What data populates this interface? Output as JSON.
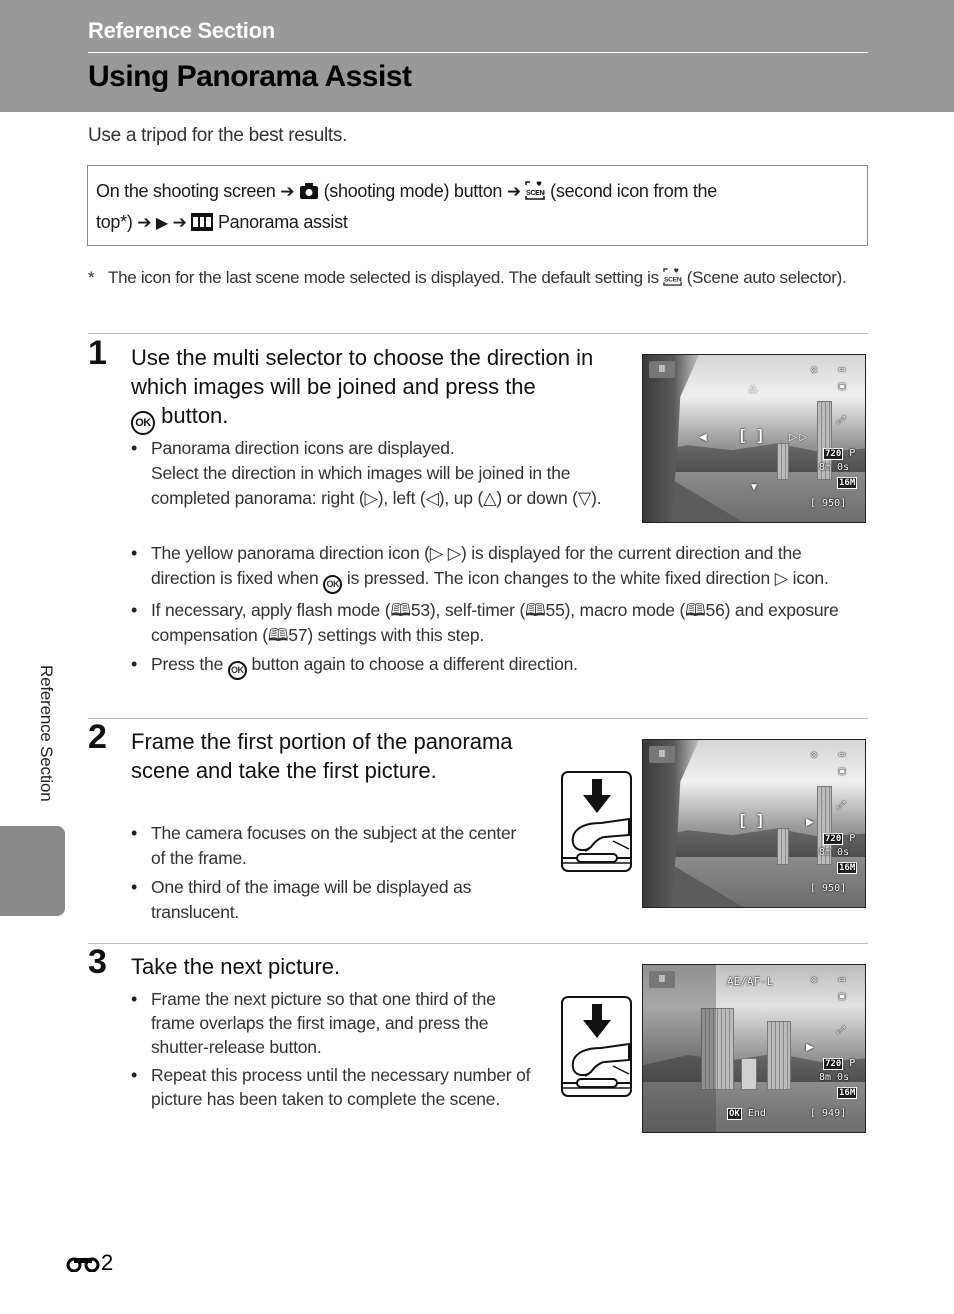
{
  "header": {
    "section_label": "Reference Section",
    "page_title": "Using Panorama Assist"
  },
  "intro": "Use a tripod for the best results.",
  "procedure": {
    "part1": "On the shooting screen",
    "part2": "(shooting mode) button",
    "part3": "(second icon from the",
    "part4": "top*)",
    "part5": "Panorama assist",
    "icons": [
      "arrow-right-icon",
      "camera-icon",
      "scene-auto-selector-icon",
      "play-triangle-icon",
      "panorama-assist-icon"
    ]
  },
  "footnote": {
    "marker": "*",
    "text_before": "The icon for the last scene mode selected is displayed. The default setting is",
    "text_after": "(Scene auto selector)."
  },
  "steps": [
    {
      "number": "1",
      "title_before": "Use the multi selector to choose the direction in which images will be joined and press the",
      "title_after": "button.",
      "bullets": [
        {
          "line1": "Panorama direction icons are displayed.",
          "line2_a": "Select the direction in which images will be joined in the completed panorama: right (",
          "line2_b": "), left (",
          "line2_c": "), up (",
          "line2_d": ") or down (",
          "line2_e": ")."
        },
        {
          "a": "The yellow panorama direction icon (",
          "b": ") is displayed for the current direction and the direction is fixed when",
          "c": "is pressed. The icon changes to the white fixed direction",
          "d": "icon."
        },
        {
          "a": "If necessary, apply flash mode (",
          "ref1": "53",
          "b": "), self-timer (",
          "ref2": "55",
          "c": "), macro mode (",
          "ref3": "56",
          "d": ") and exposure compensation (",
          "ref4": "57",
          "e": ") settings with this step."
        },
        {
          "a": "Press the",
          "b": "button again to choose a different direction."
        }
      ],
      "screen": {
        "frames_remaining": "[ 950]",
        "video_mode": "720",
        "video_mode_suffix": "P",
        "video_time": "8m 0s",
        "image_size": "16M"
      }
    },
    {
      "number": "2",
      "title": "Frame the first portion of the panorama scene and take the first picture.",
      "bullets": [
        "The camera focuses on the subject at the center of the frame.",
        "One third of the image will be displayed as translucent."
      ],
      "screen": {
        "frames_remaining": "[ 950]",
        "video_mode": "720",
        "video_mode_suffix": "P",
        "video_time": "8m 0s",
        "image_size": "16M"
      }
    },
    {
      "number": "3",
      "title": "Take the next picture.",
      "bullets": [
        "Frame the next picture so that one third of the frame overlaps the first image, and press the shutter-release button.",
        "Repeat this process until the necessary number of picture has been taken to complete the scene."
      ],
      "screen": {
        "lock_label": "AE/AF-L",
        "ok_label": "OK",
        "end_label": "End",
        "frames_remaining": "[ 949]",
        "video_mode": "720",
        "video_mode_suffix": "P",
        "video_time": "8m 0s",
        "image_size": "16M"
      }
    }
  ],
  "ok_glyph": "OK",
  "side_tab": {
    "label": "Reference Section"
  },
  "footer": {
    "page_suffix": "2"
  },
  "colors": {
    "header_bg": "#999999",
    "side_tab_bg": "#888888",
    "rule": "#bbbbbb"
  }
}
